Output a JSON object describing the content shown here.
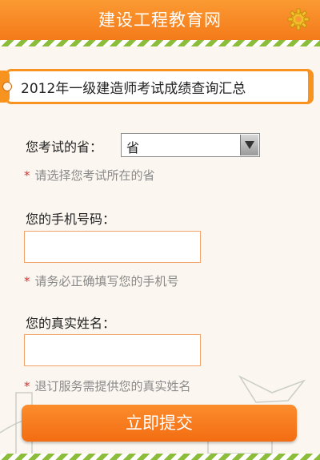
{
  "header": {
    "title": "建设工程教育网",
    "settings_icon": "gear-icon"
  },
  "banner": {
    "title": "2012年一级建造师考试成绩查询汇总"
  },
  "form": {
    "province_label": "您考试的省：",
    "province_selected": "省",
    "province_hint": "请选择您考试所在的省",
    "phone_label": "您的手机号码：",
    "phone_value": "",
    "phone_hint": "请务必正确填写您的手机号",
    "name_label": "您的真实姓名：",
    "name_value": "",
    "name_hint": "退订服务需提供您的真实姓名",
    "required_mark": "*",
    "submit_label": "立即提交"
  },
  "colors": {
    "accent": "#f7931e",
    "stripe_green": "#8bbd3b",
    "required": "#e0302c"
  }
}
